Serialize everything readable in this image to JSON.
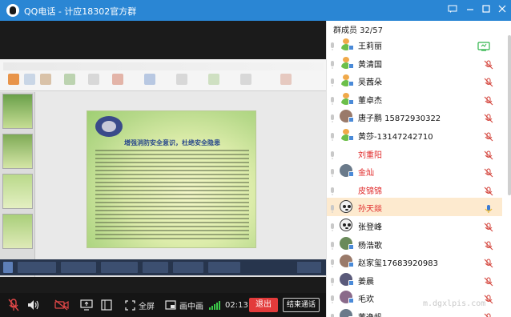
{
  "window": {
    "title": "QQ电话 - 计应18302官方群",
    "controls": [
      "min-icon",
      "max-icon",
      "close-icon"
    ]
  },
  "slide": {
    "headline": "增强消防安全意识，杜绝安全隐患"
  },
  "toolbar": {
    "fullscreen_label": "全屏",
    "pip_label": "画中画",
    "duration": "02:13",
    "exit_label": "退出",
    "end_label": "结束通话"
  },
  "panel": {
    "header": "群成员 32/57",
    "members": [
      {
        "name": "王莉丽",
        "red": false,
        "avatar": "person-avatar",
        "mic_on": true
      },
      {
        "name": "黄清国",
        "red": false,
        "avatar": "person-avatar",
        "mic_on": false
      },
      {
        "name": "吴茜朵",
        "red": false,
        "avatar": "person-avatar",
        "mic_on": false
      },
      {
        "name": "董卓杰",
        "red": false,
        "avatar": "person-avatar",
        "mic_on": false
      },
      {
        "name": "唐子鹏 15872930322",
        "red": false,
        "avatar": "photo-avatar",
        "mic_on": false
      },
      {
        "name": "黄莎-13147242710",
        "red": false,
        "avatar": "person-avatar",
        "mic_on": false
      },
      {
        "name": "刘重阳",
        "red": true,
        "avatar": "none",
        "mic_on": false
      },
      {
        "name": "金灿",
        "red": true,
        "avatar": "photo-avatar",
        "mic_on": false
      },
      {
        "name": "皮锦锦",
        "red": true,
        "avatar": "none",
        "mic_on": false
      },
      {
        "name": "孙天燚",
        "red": true,
        "avatar": "panda-avatar",
        "mic_on": true
      },
      {
        "name": "张登峰",
        "red": false,
        "avatar": "panda-avatar",
        "mic_on": false
      },
      {
        "name": "杨浩歌",
        "red": false,
        "avatar": "photo-avatar",
        "mic_on": false
      },
      {
        "name": "赵家玺17683920983",
        "red": false,
        "avatar": "photo-avatar",
        "mic_on": false
      },
      {
        "name": "姜晨",
        "red": false,
        "avatar": "photo-avatar",
        "mic_on": false
      },
      {
        "name": "毛欢",
        "red": false,
        "avatar": "photo-avatar",
        "mic_on": false
      },
      {
        "name": "董逸帆",
        "red": false,
        "avatar": "photo-avatar",
        "mic_on": false
      }
    ]
  },
  "watermark": "m.dgxlpis.com",
  "colors": {
    "titlebar": "#2a86d4",
    "exit": "#e33b3b",
    "red_name": "#e02a2a",
    "selected_row": "#fdeacf",
    "mic_active": "#2fb44a",
    "mute": "#d4453c"
  }
}
